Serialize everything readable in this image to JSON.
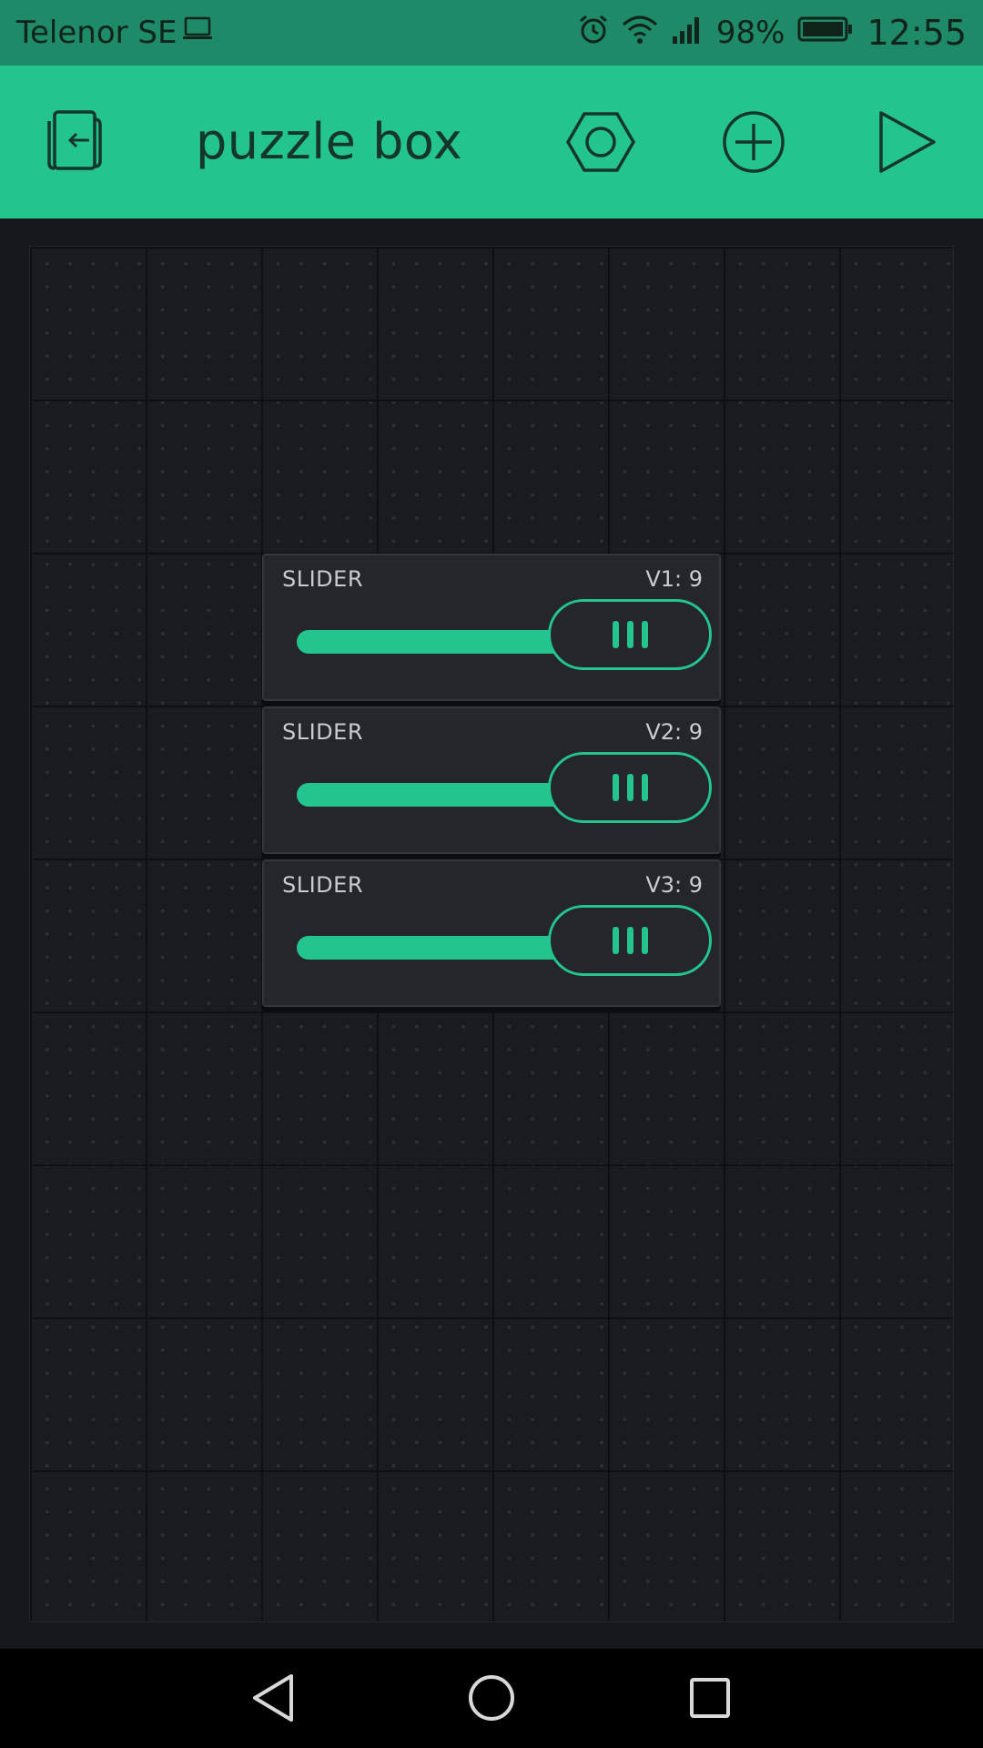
{
  "status_bar": {
    "carrier": "Telenor SE",
    "battery_percent": "98%",
    "time": "12:55",
    "icons": [
      "laptop-icon",
      "alarm-icon",
      "wifi-icon",
      "signal-icon",
      "battery-icon"
    ]
  },
  "app_bar": {
    "title": "puzzle box",
    "icons": [
      "exit-icon",
      "settings-hexagon-icon",
      "add-widget-icon",
      "play-icon"
    ]
  },
  "widgets": [
    {
      "label": "SLIDER",
      "value": "V1: 9",
      "level": 1.0
    },
    {
      "label": "SLIDER",
      "value": "V2: 9",
      "level": 1.0
    },
    {
      "label": "SLIDER",
      "value": "V3: 9",
      "level": 1.0
    }
  ],
  "nav_bar": {
    "icons": [
      "back-icon",
      "home-icon",
      "recents-icon"
    ]
  },
  "colors": {
    "accent": "#23c48e",
    "status_bar": "#1e8a67",
    "canvas": "#16171c",
    "widget_bg": "#24262b"
  }
}
